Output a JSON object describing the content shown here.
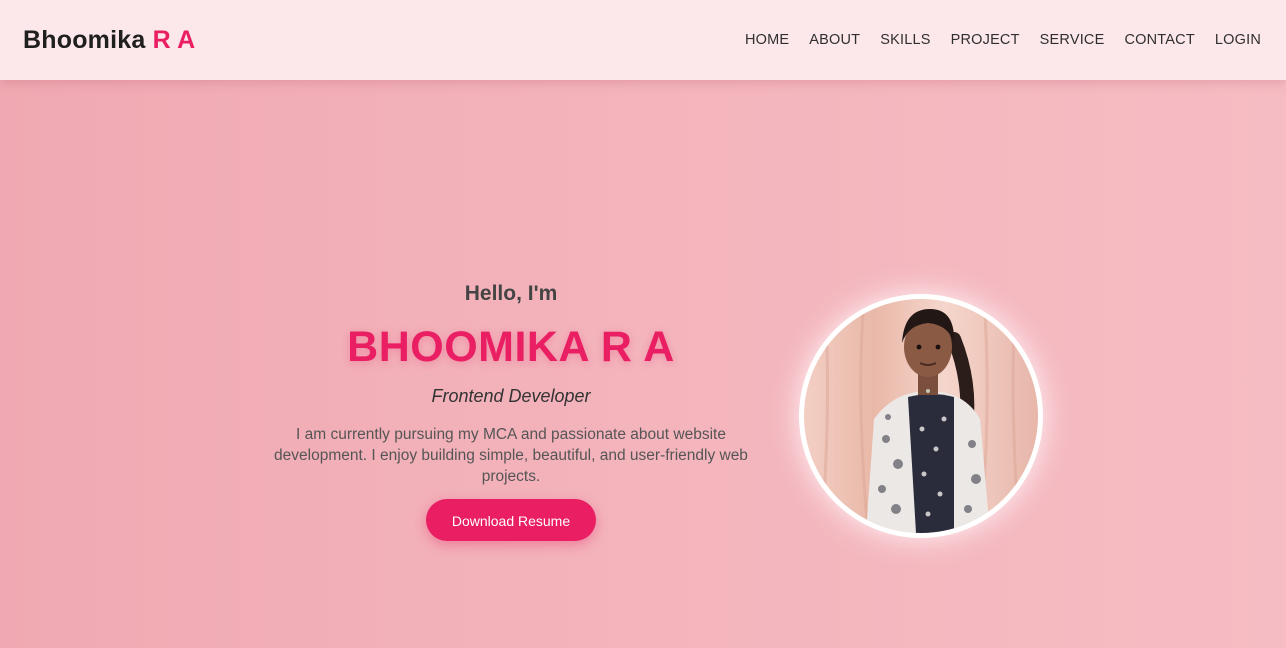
{
  "header": {
    "logo_name": "Bhoomika",
    "logo_accent": "R A"
  },
  "nav": {
    "items": [
      "HOME",
      "ABOUT",
      "SKILLS",
      "PROJECT",
      "SERVICE",
      "CONTACT",
      "LOGIN"
    ]
  },
  "hero": {
    "greeting": "Hello, I'm",
    "name": "BHOOMIKA R A",
    "role": "Frontend Developer",
    "bio": "I am currently pursuing my MCA and passionate about website development. I enjoy building simple, beautiful, and user-friendly web projects.",
    "button_label": "Download Resume"
  },
  "colors": {
    "accent": "#e91e63",
    "nav_background": "#fce7ea",
    "hero_background": "#f4b5bd"
  }
}
